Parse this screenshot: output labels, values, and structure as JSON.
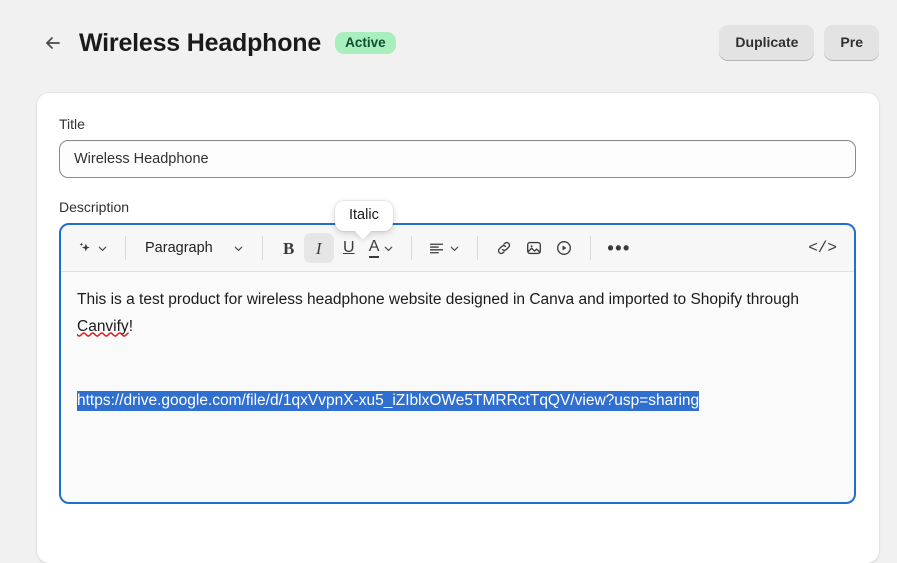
{
  "header": {
    "back_icon": "arrow-left-icon",
    "title": "Wireless Headphone",
    "status": "Active",
    "status_bg": "#a9eebd",
    "status_fg": "#0f5132",
    "actions": [
      {
        "label": "Duplicate",
        "name": "duplicate-button"
      },
      {
        "label": "Pre",
        "name": "preview-button"
      }
    ]
  },
  "form": {
    "title_label": "Title",
    "title_value": "Wireless Headphone",
    "title_placeholder": "Title",
    "description_label": "Description"
  },
  "toolbar": {
    "ai_label": "ai-sparkle-icon",
    "block_format": "Paragraph",
    "bold_label": "B",
    "italic_label": "I",
    "underline_label": "U",
    "text_color_label": "A",
    "more_label": "•••",
    "code_label": "</>",
    "items": [
      {
        "name": "ai-assist-button",
        "icon": "sparkle-icon"
      },
      {
        "name": "block-format-select",
        "icon": "chevron-down-icon"
      },
      {
        "name": "bold-button",
        "icon": "bold-icon"
      },
      {
        "name": "italic-button",
        "icon": "italic-icon"
      },
      {
        "name": "underline-button",
        "icon": "underline-icon"
      },
      {
        "name": "text-color-button",
        "icon": "text-color-icon"
      },
      {
        "name": "align-button",
        "icon": "align-left-icon"
      },
      {
        "name": "link-button",
        "icon": "link-icon"
      },
      {
        "name": "image-button",
        "icon": "image-icon"
      },
      {
        "name": "video-button",
        "icon": "play-circle-icon"
      },
      {
        "name": "more-options-button",
        "icon": "ellipsis-icon"
      },
      {
        "name": "code-view-button",
        "icon": "code-icon"
      }
    ],
    "active_item": "italic-button"
  },
  "tooltip": {
    "text": "Italic"
  },
  "editor": {
    "paragraph_part1": "This is a test product for wireless headphone website designed in Canva and imported to Shopify through ",
    "paragraph_misspelled": "Canvify",
    "paragraph_part2": "!",
    "selected_url": "https://drive.google.com/file/d/1qxVvpnX-xu5_iZIblxOWe5TMRRctTqQV/view?usp=sharing",
    "selection_bg": "#2f6fd0",
    "selection_fg": "#ffffff",
    "focus_ring_color": "#1f6fd0"
  }
}
